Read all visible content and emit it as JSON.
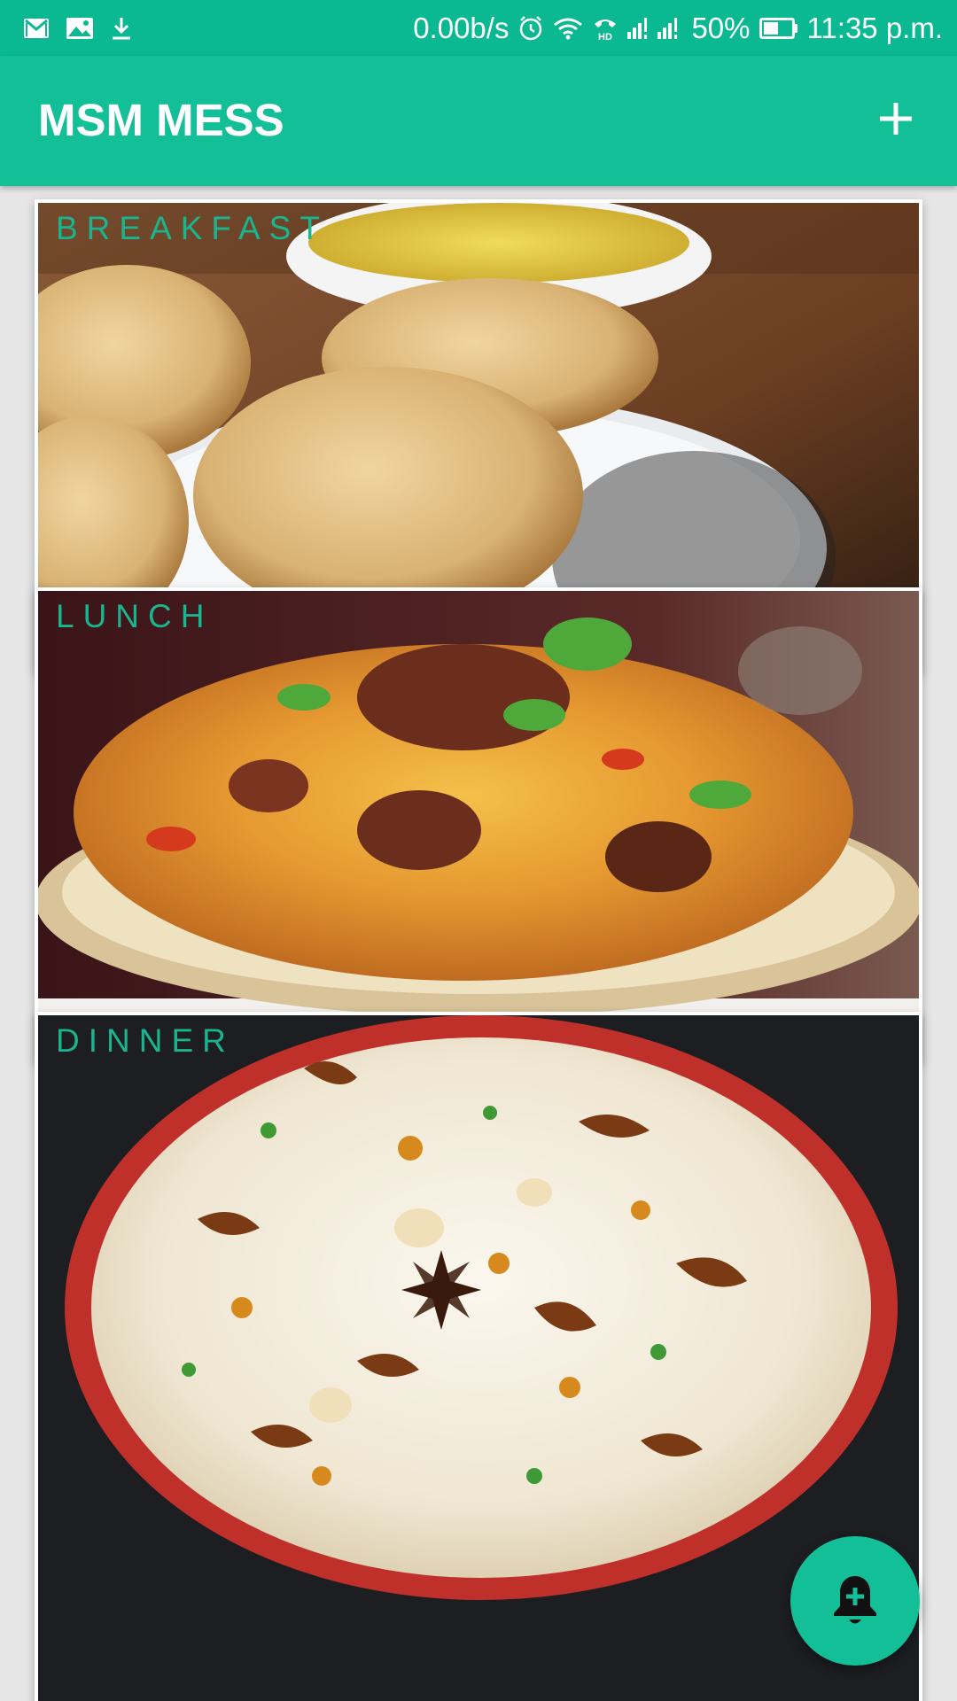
{
  "status_bar": {
    "left_icons": [
      "gmail-icon",
      "gallery-icon",
      "download-icon"
    ],
    "network_speed": "0.00b/s",
    "battery_percent": "50%",
    "battery_level": 0.5,
    "time": "11:35 p.m.",
    "right_icons": [
      "alarm-icon",
      "wifi-icon",
      "hd-call-icon",
      "signal-icon",
      "battery-icon"
    ]
  },
  "app_bar": {
    "title": "MSM MESS",
    "action_icon": "plus-icon"
  },
  "meals": [
    {
      "label": "BREAKFAST",
      "image": "puri-with-potato-curry"
    },
    {
      "label": "LUNCH",
      "image": "biryani-plate"
    },
    {
      "label": "DINNER",
      "image": "pulao-bowl"
    }
  ],
  "fab": {
    "icon": "add-alert-bell-icon"
  },
  "colors": {
    "primary": "#13bf97",
    "status_bar": "#0ab892",
    "label_text": "#1ab48e",
    "background": "#e6e6e6"
  }
}
